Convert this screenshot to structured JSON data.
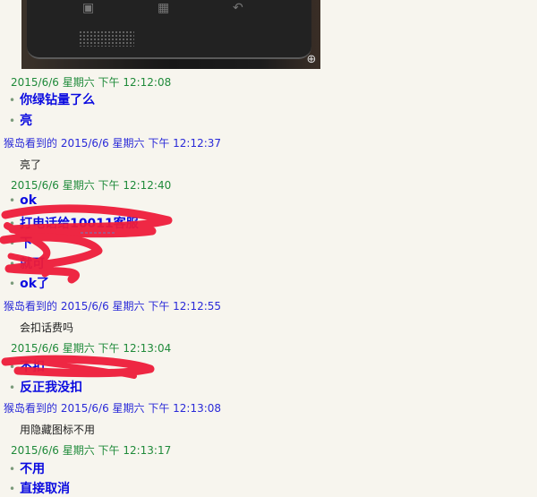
{
  "image": {
    "zoom_icon": "plus-icon"
  },
  "chat": {
    "items": [
      {
        "kind": "time",
        "text": "2015/6/6 星期六 下午 12:12:08"
      },
      {
        "kind": "bold",
        "text": "你绿钻量了么"
      },
      {
        "kind": "bold",
        "text": "亮"
      },
      {
        "kind": "sender",
        "text": "猴岛看到的 2015/6/6 星期六 下午 12:12:37"
      },
      {
        "kind": "plain",
        "text": "亮了"
      },
      {
        "kind": "time",
        "text": "2015/6/6 星期六 下午 12:12:40"
      },
      {
        "kind": "bold",
        "text": "ok"
      },
      {
        "kind": "bold",
        "text": "打电话给10011客服"
      },
      {
        "kind": "bold",
        "text": "下"
      },
      {
        "kind": "bold",
        "text": "就可"
      },
      {
        "kind": "bold",
        "text": "ok了"
      },
      {
        "kind": "sender",
        "text": "猴岛看到的 2015/6/6 星期六 下午 12:12:55"
      },
      {
        "kind": "plain",
        "text": "会扣话费吗"
      },
      {
        "kind": "time",
        "text": "2015/6/6 星期六 下午 12:13:04"
      },
      {
        "kind": "bold",
        "text": "不扣"
      },
      {
        "kind": "bold",
        "text": "反正我没扣"
      },
      {
        "kind": "sender",
        "text": "猴岛看到的 2015/6/6 星期六 下午 12:13:08"
      },
      {
        "kind": "plain",
        "text": "用隐藏图标不用"
      },
      {
        "kind": "time",
        "text": "2015/6/6 星期六 下午 12:13:17"
      },
      {
        "kind": "bold",
        "text": "不用"
      },
      {
        "kind": "bold",
        "text": "直接取消"
      }
    ]
  }
}
